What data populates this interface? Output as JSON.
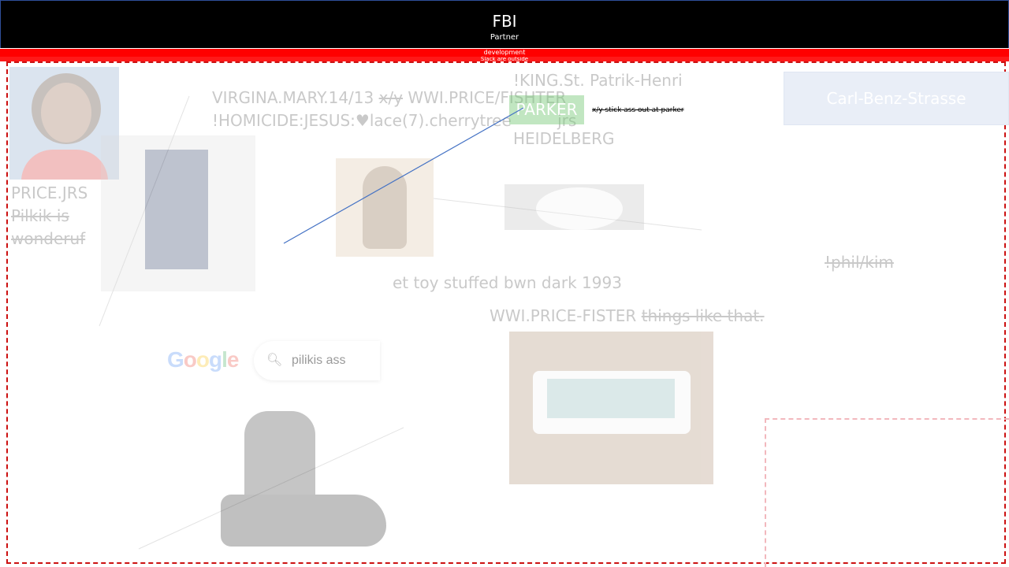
{
  "header": {
    "title": "FBI",
    "subtitle": "Partner"
  },
  "banner": {
    "line1": "development",
    "line2": "Slack are outside"
  },
  "texts": {
    "virgina": "VIRGINA.MARY.14/13",
    "virgina_strike": "x/y",
    "virgina_tail": "WWI.PRICE/FISHTER",
    "homicide": "!HOMICIDE:JESUS:♥lace(7).cherrytree",
    "homicide_tail": "jrs",
    "king": "!KING.St. Patrik-Henri",
    "heidelberg": "HEIDELBERG",
    "parker": "PARKER",
    "stick_note": "x/y stick ass out at parker",
    "carl_benz": "Carl-Benz-Strasse",
    "price_jrs": "PRICE.JRS",
    "pilkik_is": "Pilkik is",
    "wonderuf": "wonderuf",
    "et_toy": "et toy stuffed bwn dark 1993",
    "phil_kim": "!phil/kim",
    "price_fister": "WWI.PRICE-FISTER",
    "things_like_that": "things like that."
  },
  "search": {
    "query": "pilikis ass",
    "logo": [
      "G",
      "o",
      "o",
      "g",
      "l",
      "e"
    ]
  },
  "images": {
    "portrait": "portrait-photo",
    "et_tape": "et-vhs-photo",
    "et_toy": "et-toy-photo",
    "fluffy": "fluffy-photo",
    "air_hockey": "air-hockey-table-photo",
    "boot": "boot-photo"
  },
  "colors": {
    "header_bg": "#000000",
    "banner": "#ff0000",
    "dashed_border": "#cc1111",
    "parker_bg": "#77c977",
    "carl_benz_bg": "#e9eef7",
    "line_blue": "#4472c4"
  }
}
